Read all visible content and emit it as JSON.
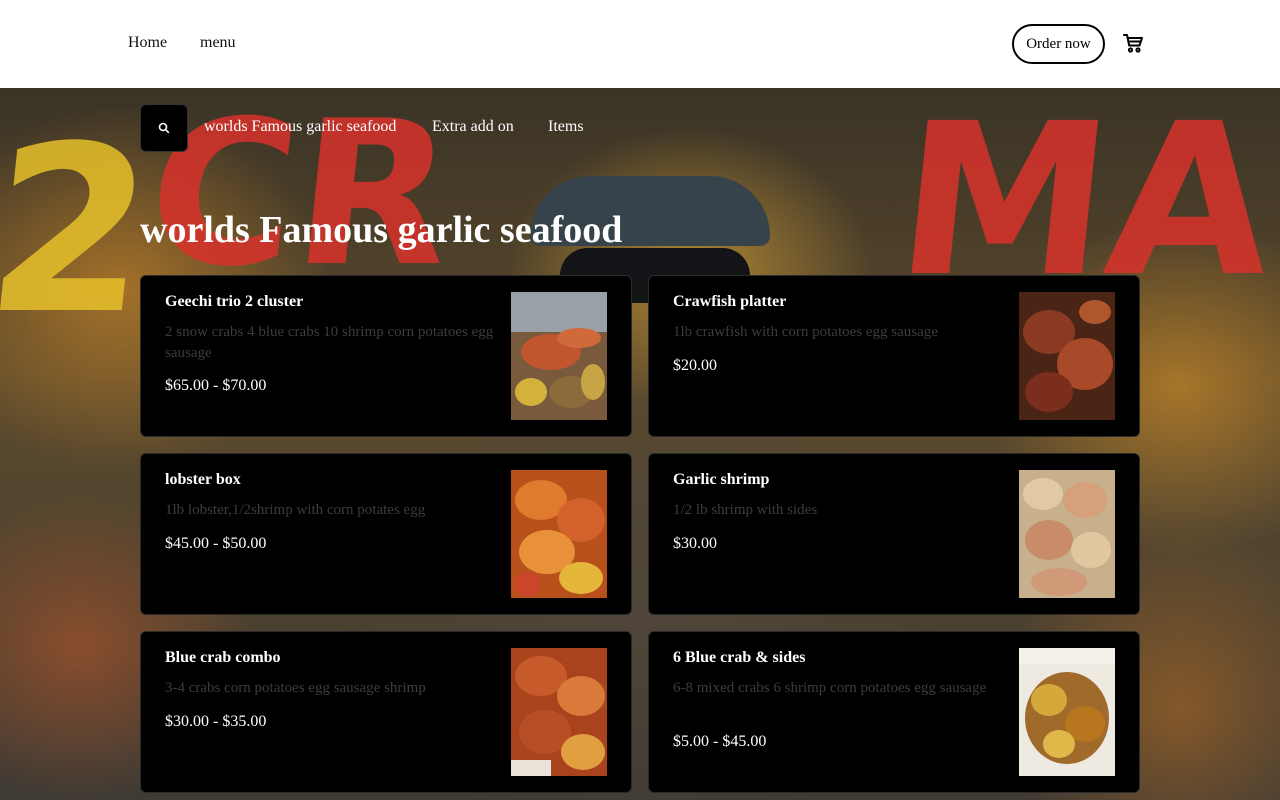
{
  "header": {
    "nav": [
      "Home",
      "menu"
    ],
    "order_label": "Order now"
  },
  "categories": {
    "items": [
      "worlds Famous garlic seafood",
      "Extra add on",
      "Items"
    ]
  },
  "section": {
    "title": "worlds Famous garlic seafood"
  },
  "menu_items": [
    {
      "name": "Geechi trio 2 cluster",
      "description": "2 snow crabs 4 blue crabs 10 shrimp corn potatoes egg sausage",
      "price": "$65.00 - $70.00"
    },
    {
      "name": "Crawfish platter",
      "description": "1lb crawfish with corn potatoes egg sausage",
      "price": "$20.00"
    },
    {
      "name": "lobster box",
      "description": "1lb lobster,1/2shrimp with corn potates egg",
      "price": "$45.00 - $50.00"
    },
    {
      "name": "Garlic shrimp",
      "description": "1/2 lb shrimp with sides",
      "price": "$30.00"
    },
    {
      "name": "Blue crab combo",
      "description": "3-4 crabs corn potatoes egg sausage shrimp",
      "price": "$30.00 - $35.00"
    },
    {
      "name": "6 Blue crab & sides",
      "description": "6-8 mixed crabs 6 shrimp corn potatoes egg sausage",
      "price": "$5.00 - $45.00"
    }
  ],
  "icons": {
    "search": "search-icon",
    "cart": "cart-icon"
  },
  "colors": {
    "card_bg": "#000000",
    "desc_text": "#3c3c3c",
    "header_bg": "#ffffff"
  }
}
